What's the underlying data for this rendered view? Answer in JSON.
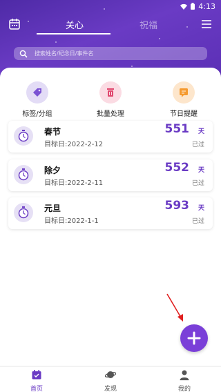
{
  "status_bar": {
    "time": "4:13"
  },
  "tabs": [
    {
      "label": "关心",
      "active": true
    },
    {
      "label": "祝福",
      "active": false
    }
  ],
  "search": {
    "placeholder": "搜索姓名/纪念日/事件名"
  },
  "actions": [
    {
      "label": "标签/分组",
      "icon": "tag-icon",
      "color": "#e3dcf6"
    },
    {
      "label": "批量处理",
      "icon": "trash-icon",
      "color": "#fbdbe3"
    },
    {
      "label": "节日提醒",
      "icon": "message-icon",
      "color": "#fde6cc"
    }
  ],
  "events": [
    {
      "name": "春节",
      "target": "目标日:2022-2-12",
      "days": "551",
      "unit": "天",
      "status": "已过"
    },
    {
      "name": "除夕",
      "target": "目标日:2022-2-11",
      "days": "552",
      "unit": "天",
      "status": "已过"
    },
    {
      "name": "元旦",
      "target": "目标日:2022-1-1",
      "days": "593",
      "unit": "天",
      "status": "已过"
    }
  ],
  "bottom_nav": [
    {
      "label": "首页",
      "active": true
    },
    {
      "label": "发现",
      "active": false
    },
    {
      "label": "我的",
      "active": false
    }
  ],
  "colors": {
    "accent": "#6a3bc4",
    "header_gradient_start": "#4e2aa6",
    "fab": "#7a3fd8",
    "nav_active": "#6a3bc4",
    "nav_inactive": "#555555"
  }
}
